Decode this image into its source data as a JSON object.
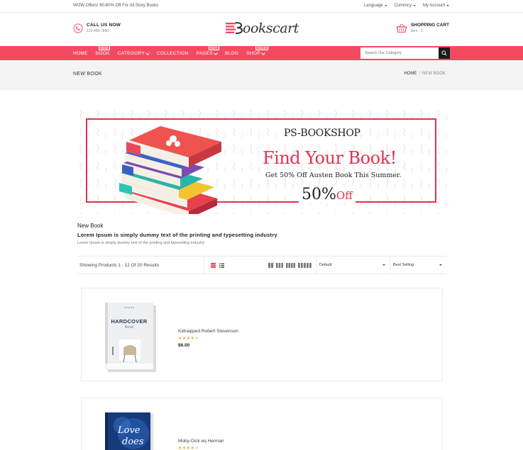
{
  "topbar": {
    "promo": "WOW Offers! 60-80% Off For All Story Books",
    "language": "Language",
    "currency": "Currency",
    "account": "My Account"
  },
  "header": {
    "call_label": "CALL US NOW",
    "phone": "123-456-7890",
    "logo_text": "ookscart",
    "cart_label": "SHOPPING CART",
    "cart_sub": "item - 1"
  },
  "nav": {
    "items": [
      {
        "label": "HOME"
      },
      {
        "label": "BOOK",
        "badge": "NEW"
      },
      {
        "label": "CATEGORY"
      },
      {
        "label": "COLLECTION"
      },
      {
        "label": "PAGES",
        "badge": "HOT"
      },
      {
        "label": "BLOG"
      },
      {
        "label": "SHOP",
        "badge": "SALE"
      }
    ],
    "search_placeholder": "Search Our Category"
  },
  "breadcrumb": {
    "page_title": "NEW BOOK",
    "home": "HOME",
    "sep": "/",
    "current": "NEW BOOK"
  },
  "banner": {
    "brand": "PS-BOOKSHOP",
    "headline": "Find Your Book!",
    "offer": "Get 50% Off Austen Book This Summer.",
    "percent": "50%",
    "off": "Off"
  },
  "category": {
    "title": "New Book",
    "subtitle": "Lorem Ipsum is simply dummy text of the printing and typesetting industry",
    "description": "Lorem Ipsum is simply dummy text of the printing and typesetting industry"
  },
  "toolbar": {
    "showing": "Showing Products 1 - 12 Of 20 Results",
    "sort_default": "Default",
    "sort_best": "Best Selling"
  },
  "products": [
    {
      "name": "Kidnapped Robert Stevenson",
      "rating": 4,
      "price": "$6.00",
      "cover_title": "HARDCOVER",
      "cover_sub": "Book"
    },
    {
      "name": "Moby-Dick eq Herman",
      "rating": 4,
      "price": "",
      "cover_title": "Love",
      "cover_sub": "does"
    }
  ],
  "colors": {
    "accent": "#f44a5f",
    "banner_red": "#e5304e",
    "star": "#f5a623"
  }
}
